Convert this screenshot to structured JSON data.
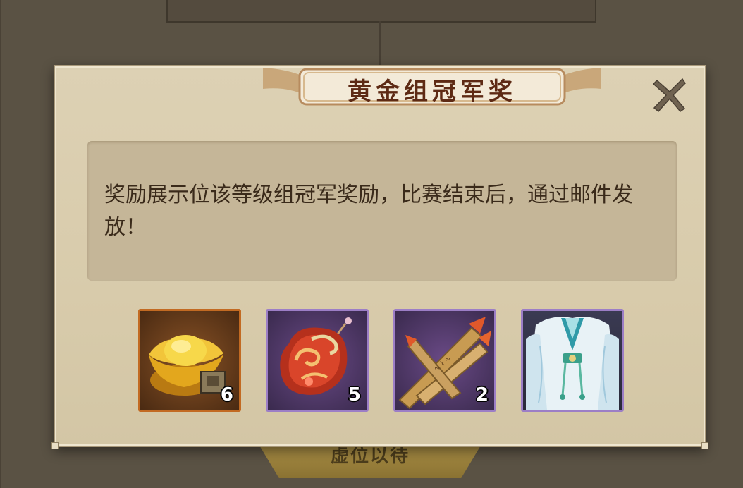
{
  "background": {
    "button_label": "虚位以待"
  },
  "dialog": {
    "title": "黄金组冠军奖",
    "description": "奖励展示位该等级组冠军奖励，比赛结束后，通过邮件发放！",
    "close_icon": "close-x-icon",
    "items": [
      {
        "icon": "gold-ingot-icon",
        "count": "6",
        "rarity_color": "#c26a22"
      },
      {
        "icon": "red-jade-pendant-icon",
        "count": "5",
        "rarity_color": "#9c7ec6"
      },
      {
        "icon": "incense-sticks-icon",
        "count": "2",
        "rarity_color": "#9c7ec6"
      },
      {
        "icon": "white-robe-outfit-icon",
        "count": "",
        "rarity_color": "#9c7ec6"
      }
    ]
  }
}
